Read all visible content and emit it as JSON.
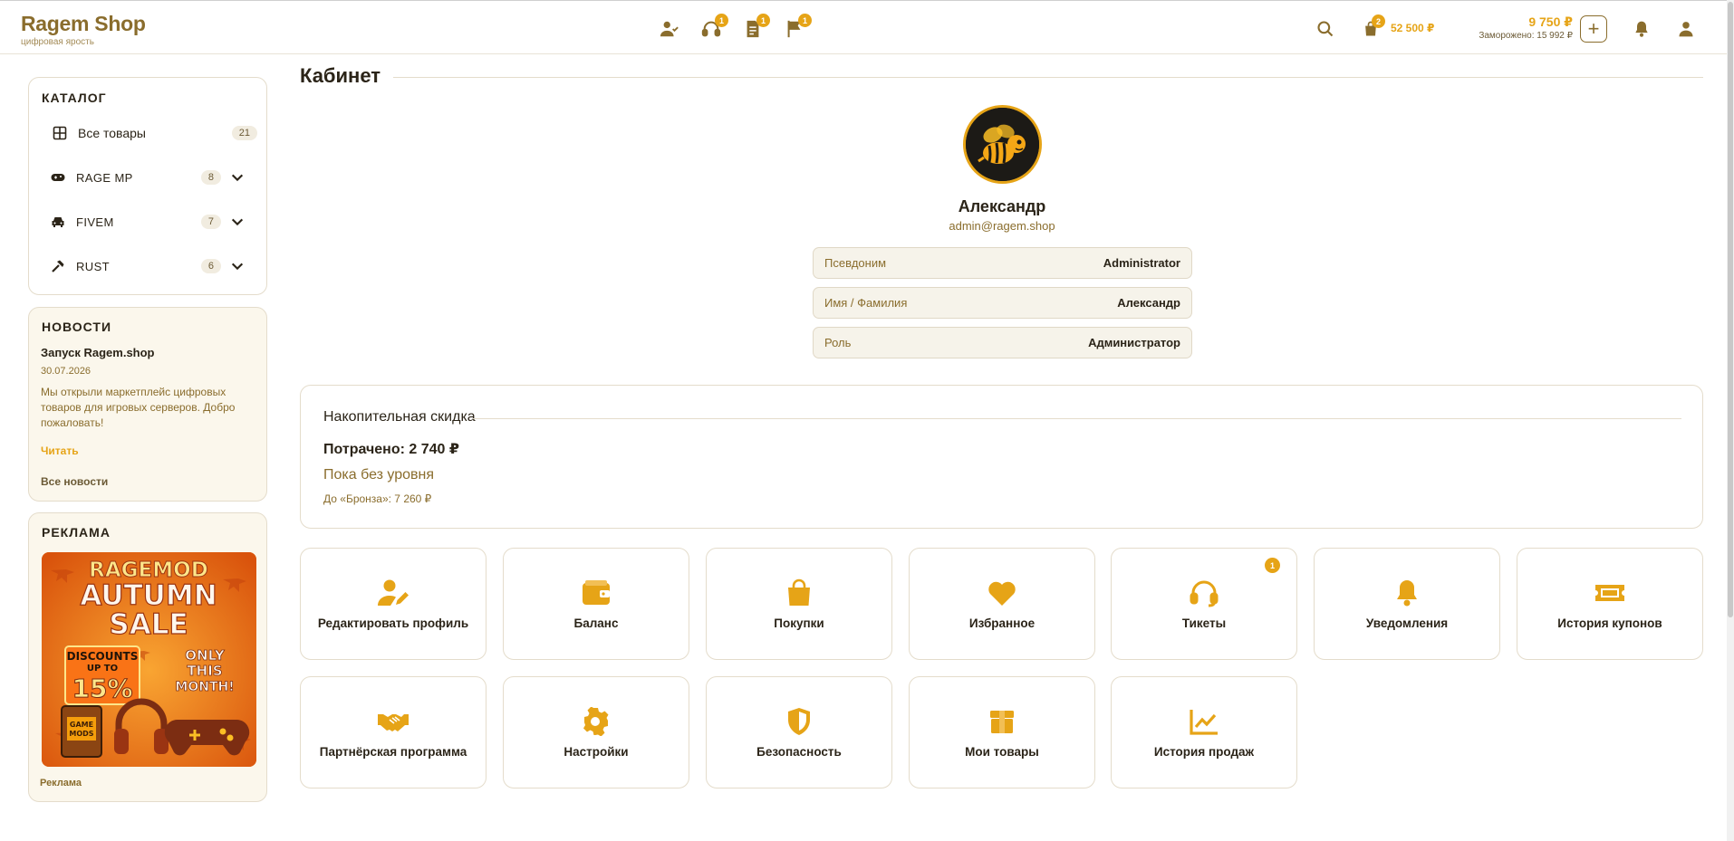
{
  "brand": {
    "name": "Ragem Shop",
    "tagline": "цифровая ярость"
  },
  "topnav": {
    "icons": [
      {
        "name": "user-check-icon",
        "badge": ""
      },
      {
        "name": "headset-icon",
        "badge": "1"
      },
      {
        "name": "document-icon",
        "badge": "1"
      },
      {
        "name": "flag-icon",
        "badge": "1"
      }
    ]
  },
  "header": {
    "cart_badge": "2",
    "cart_total": "52 500 ₽",
    "balance": "9 750 ₽",
    "frozen": "Заморожено: 15 992 ₽"
  },
  "catalog": {
    "title": "КАТАЛОГ",
    "items": [
      {
        "label": "Все товары",
        "count": "21",
        "icon": "grid-icon",
        "expandable": false
      },
      {
        "label": "RAGE MP",
        "count": "8",
        "icon": "gamepad-icon",
        "expandable": true
      },
      {
        "label": "FIVEM",
        "count": "7",
        "icon": "car-icon",
        "expandable": true
      },
      {
        "label": "RUST",
        "count": "6",
        "icon": "hammer-icon",
        "expandable": true
      }
    ]
  },
  "news": {
    "title": "НОВОСТИ",
    "item_title": "Запуск Ragem.shop",
    "item_date": "30.07.2026",
    "item_text": "Мы открыли маркетплейс цифровых товаров для игровых серверов. Добро пожаловать!",
    "read_link": "Читать",
    "all_link": "Все новости"
  },
  "ad": {
    "title": "РЕКЛАМА",
    "img_line1": "RAGEMOD",
    "img_line2": "AUTUMN",
    "img_line3": "SALE",
    "img_disc1": "DISCOUNTS",
    "img_disc2": "UP TO",
    "img_disc3": "15%",
    "img_only1": "ONLY",
    "img_only2": "THIS",
    "img_only3": "MONTH!",
    "img_mods1": "GAME",
    "img_mods2": "MODS",
    "caption": "Реклама"
  },
  "page": {
    "title": "Кабинет"
  },
  "profile": {
    "name": "Александр",
    "email": "admin@ragem.shop",
    "rows": [
      {
        "key": "Псевдоним",
        "value": "Administrator"
      },
      {
        "key": "Имя / Фамилия",
        "value": "Александр"
      },
      {
        "key": "Роль",
        "value": "Администратор"
      }
    ]
  },
  "discount": {
    "title": "Накопительная скидка",
    "spent": "Потрачено: 2 740 ₽",
    "level": "Пока без уровня",
    "next": "До «Бронза»: 7 260 ₽"
  },
  "tiles": [
    {
      "label": "Редактировать профиль",
      "icon": "user-edit-icon",
      "badge": ""
    },
    {
      "label": "Баланс",
      "icon": "wallet-icon",
      "badge": ""
    },
    {
      "label": "Покупки",
      "icon": "shopping-bag-icon",
      "badge": ""
    },
    {
      "label": "Избранное",
      "icon": "heart-icon",
      "badge": ""
    },
    {
      "label": "Тикеты",
      "icon": "headset-icon",
      "badge": "1"
    },
    {
      "label": "Уведомления",
      "icon": "bell-icon",
      "badge": ""
    },
    {
      "label": "История купонов",
      "icon": "ticket-icon",
      "badge": ""
    },
    {
      "label": "Партнёрская программа",
      "icon": "handshake-icon",
      "badge": ""
    },
    {
      "label": "Настройки",
      "icon": "gear-icon",
      "badge": ""
    },
    {
      "label": "Безопасность",
      "icon": "shield-icon",
      "badge": ""
    },
    {
      "label": "Мои товары",
      "icon": "box-icon",
      "badge": ""
    },
    {
      "label": "История продаж",
      "icon": "chart-line-icon",
      "badge": ""
    }
  ],
  "colors": {
    "accent": "#e6a417",
    "brand": "#8a6d2d",
    "text": "#2b2418",
    "card_bg": "#fbf7ec"
  }
}
